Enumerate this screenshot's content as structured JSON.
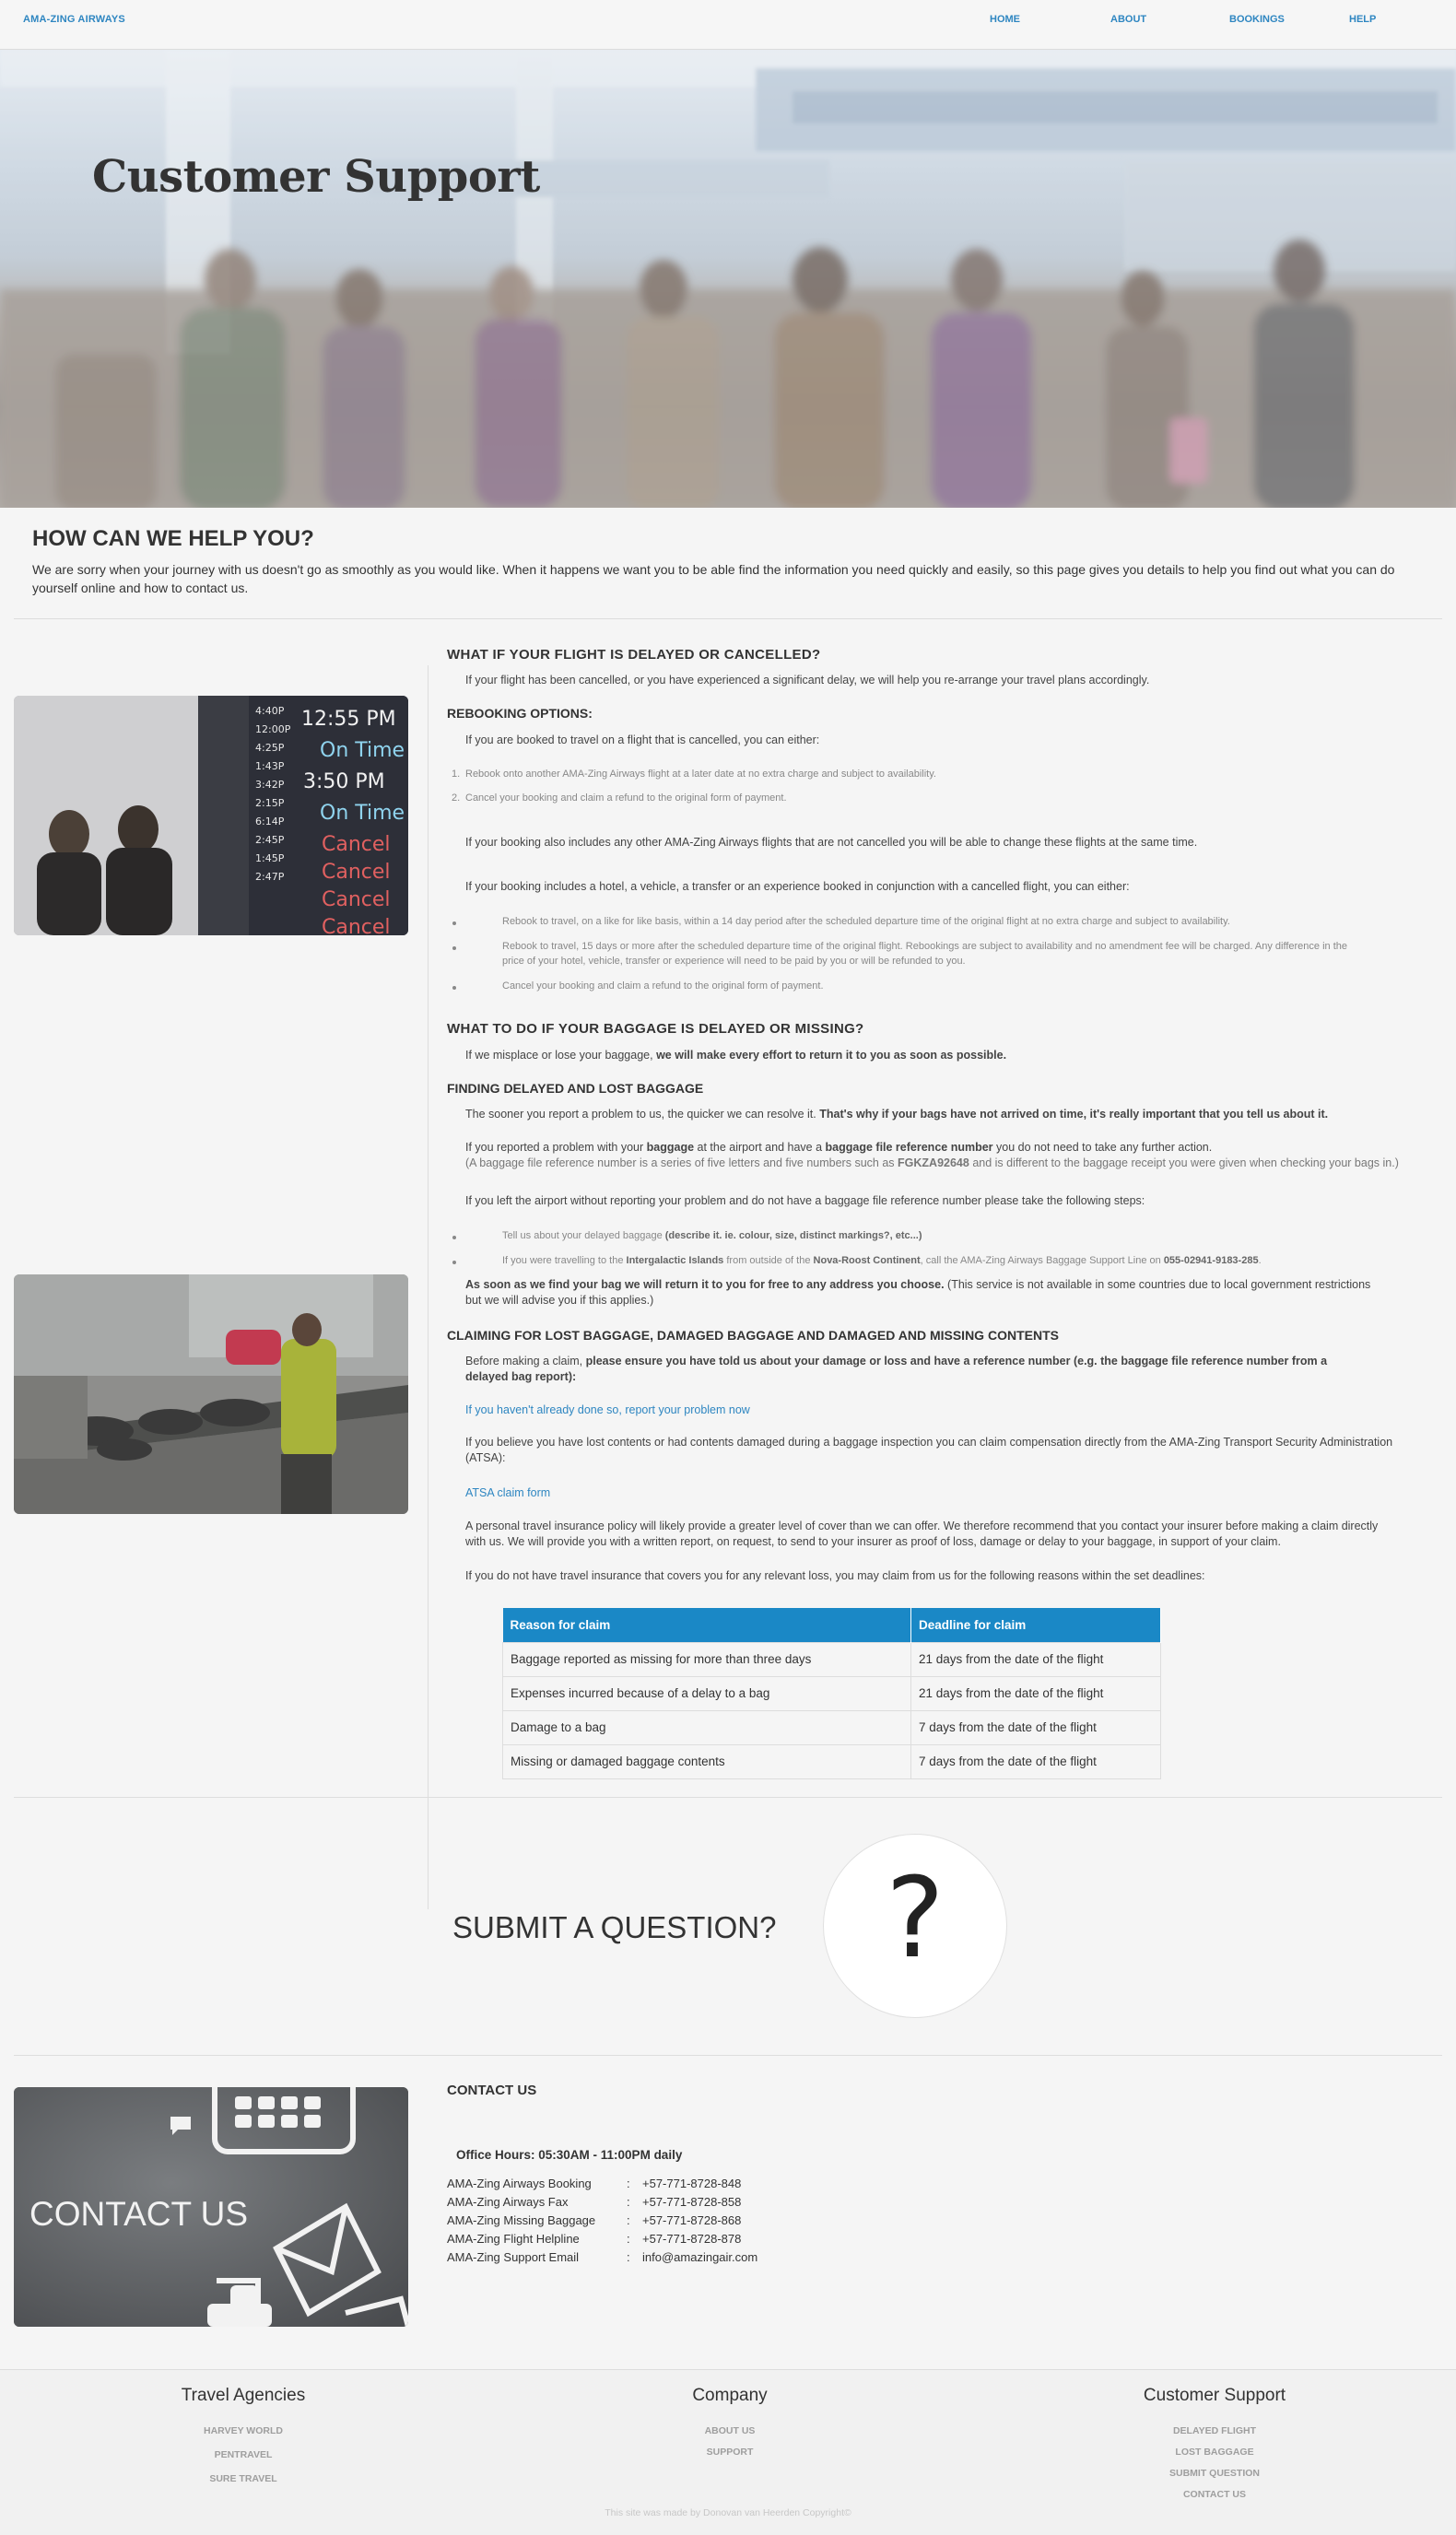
{
  "nav": {
    "brand": "AMA-ZING AIRWAYS",
    "links": [
      "HOME",
      "ABOUT",
      "BOOKINGS",
      "HELP"
    ]
  },
  "hero": {
    "title": "Customer Support"
  },
  "help": {
    "heading": "HOW CAN WE HELP YOU?",
    "text": "We are sorry when your journey with us doesn't go as smoothly as you would like. When it happens we want you to be able find the information you need quickly and easily, so this page gives you details to help you find out what you can do yourself online and how to contact us."
  },
  "images": {
    "departures_board": [
      "12:55 PM",
      "On Time",
      "3:50 PM",
      "On Time",
      "Cancel",
      "Cancel",
      "Cancel",
      "Cancel"
    ],
    "departures_times": [
      "4:40P",
      "12:00P",
      "4:25P",
      "1:43P",
      "3:42P",
      "2:15P",
      "6:14P",
      "2:45P",
      "1:45P",
      "2:47P"
    ],
    "contact_banner": "CONTACT US"
  },
  "delayed": {
    "heading": "WHAT IF YOUR FLIGHT IS DELAYED OR CANCELLED?",
    "intro": "If your flight has been cancelled, or you have experienced a significant delay, we will help you re-arrange your travel plans accordingly.",
    "rebook_heading": "REBOOKING OPTIONS:",
    "rebook_intro": "If you are booked to travel on a flight that is cancelled, you can either:",
    "rebook_list": [
      "Rebook onto another AMA-Zing Airways flight at a later date at no extra charge and subject to availability.",
      "Cancel your booking and claim a refund to the original form of payment."
    ],
    "other_flights": "If your booking also includes any other AMA-Zing Airways flights that are not cancelled you will be able to change these flights at the same time.",
    "hotel_intro": "If your booking includes a hotel, a vehicle, a transfer or an experience booked in conjunction with a cancelled flight, you can either:",
    "hotel_list": [
      "Rebook to travel, on a like for like basis, within a 14 day period after the scheduled departure time of the original flight at no extra charge and subject to availability.",
      "Rebook to travel, 15 days or more after the scheduled departure time of the original flight. Rebookings are subject to availability and no amendment fee will be charged. Any difference in the",
      "price of your hotel, vehicle, transfer or experience will need to be paid by you or will be refunded to you.",
      "Cancel your booking and claim a refund to the original form of payment."
    ]
  },
  "baggage": {
    "heading": "WHAT TO DO IF YOUR BAGGAGE IS DELAYED OR MISSING?",
    "intro_plain": "If we misplace or lose your baggage,",
    "intro_bold": "we will make every effort to return it to you as soon as possible.",
    "finding_heading": "FINDING DELAYED AND LOST BAGGAGE",
    "sooner_plain": "The sooner you report a problem to us, the quicker we can resolve it.",
    "sooner_bold": "That's why if your bags have not arrived on time, it's really important that you tell us about it.",
    "reported_1": "If you reported a problem with your",
    "reported_2": "baggage",
    "reported_3": "at the airport and have a",
    "reported_4": "baggage file reference number",
    "reported_5": "you do not need to take any further action.",
    "ref_note_1": "(A baggage file reference number is a series of five letters and five numbers such as",
    "ref_note_code": "FGKZA92648",
    "ref_note_2": "and is different to the baggage receipt you were given when checking your bags in.)",
    "left_airport": "If you left the airport without reporting your problem and do not have a baggage file reference number please take the following steps:",
    "step1_plain": "Tell us about your delayed baggage",
    "step1_bold": "(describe it. ie. colour, size, distinct markings?, etc...)",
    "step2_a": "If you were travelling to the",
    "step2_b": "Intergalactic Islands",
    "step2_c": "from outside of the",
    "step2_d": "Nova-Roost Continent",
    "step2_e": ", call the AMA-Zing Airways Baggage Support Line on",
    "step2_phone": "055-02941-9183-285",
    "found_bold": "As soon as we find your bag we will return it to you for free to any address you choose.",
    "found_plain": "(This service is not available in some countries due to local government restrictions",
    "found_plain2": "but we will advise you if this applies.)"
  },
  "claims": {
    "heading": "CLAIMING FOR LOST BAGGAGE, DAMAGED BAGGAGE AND DAMAGED AND MISSING CONTENTS",
    "before_plain": "Before making a claim,",
    "before_bold": "please ensure you have told us about your damage or loss and have a reference number (e.g. the baggage file reference number from a",
    "before_bold2": "delayed bag report):",
    "report_link": "If you haven't already done so, report your problem now",
    "atsa_text": "If you believe you have lost contents or had contents damaged during a baggage inspection you can claim compensation directly from the AMA-Zing Transport Security Administration",
    "atsa_text2": "(ATSA):",
    "atsa_link": "ATSA claim form",
    "insurance_text": "A personal travel insurance policy will likely provide a greater level of cover than we can offer. We therefore recommend that you contact your insurer before making a claim directly",
    "insurance_text2": "with us. We will provide you with a written report, on request, to send to your insurer as proof of loss, damage or delay to your baggage, in support of your claim.",
    "no_insurance": "If you do not have travel insurance that covers you for any relevant loss, you may claim from us for the following reasons within the set deadlines:",
    "table_headers": [
      "Reason for claim",
      "Deadline for claim"
    ],
    "table_rows": [
      [
        "Baggage reported as missing for more than three days",
        "21 days from the date of the flight"
      ],
      [
        "Expenses incurred because of a delay to a bag",
        "21 days from the date of the flight"
      ],
      [
        "Damage to a bag",
        "7 days from the date of the flight"
      ],
      [
        "Missing or damaged baggage contents",
        "7 days from the date of the flight"
      ]
    ]
  },
  "submit": {
    "text": "SUBMIT A QUESTION?",
    "icon": "?"
  },
  "contact": {
    "heading": "CONTACT US",
    "office_hours": "Office Hours: 05:30AM - 11:00PM daily",
    "rows": [
      [
        "AMA-Zing Airways Booking",
        "+57-771-8728-848"
      ],
      [
        "AMA-Zing Airways Fax",
        "+57-771-8728-858"
      ],
      [
        "AMA-Zing Missing Baggage",
        "+57-771-8728-868"
      ],
      [
        "AMA-Zing Flight Helpline",
        "+57-771-8728-878"
      ],
      [
        "AMA-Zing Support Email",
        "info@amazingair.com"
      ]
    ]
  },
  "footer": {
    "columns": [
      {
        "title": "Travel Agencies",
        "links": [
          "HARVEY WORLD",
          "PENTRAVEL",
          "SURE TRAVEL"
        ]
      },
      {
        "title": "Company",
        "links": [
          "ABOUT US",
          "SUPPORT"
        ]
      },
      {
        "title": "Customer Support",
        "links": [
          "DELAYED FLIGHT",
          "LOST BAGGAGE",
          "SUBMIT QUESTION",
          "CONTACT US"
        ]
      }
    ],
    "credit": "This site was made by Donovan van Heerden Copyright©"
  }
}
